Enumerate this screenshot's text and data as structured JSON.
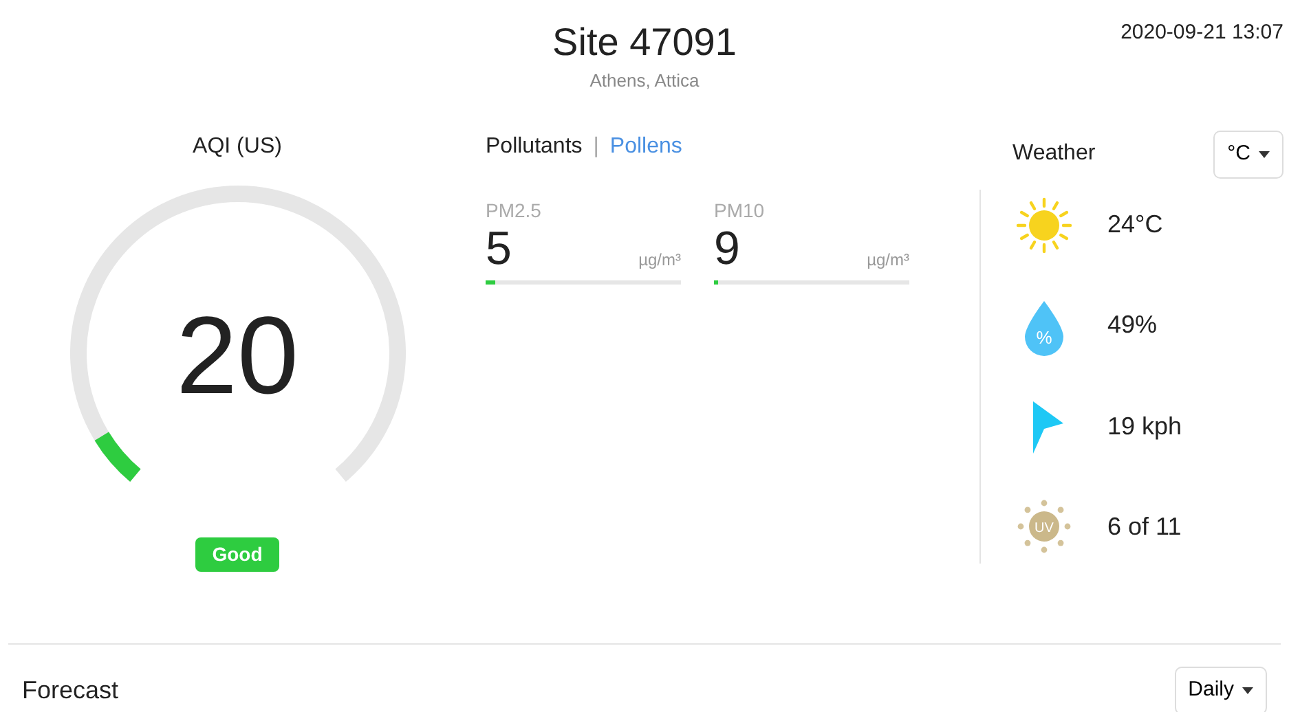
{
  "header": {
    "title": "Site 47091",
    "location": "Athens, Attica",
    "timestamp": "2020-09-21 13:07"
  },
  "aqi": {
    "title": "AQI (US)",
    "value": "20",
    "category": "Good",
    "color": "#2ecc40"
  },
  "pollutant_tabs": [
    {
      "label": "Pollutants",
      "selected": true
    },
    {
      "label": "Pollens",
      "selected": false
    }
  ],
  "tab_separator": "|",
  "pollutants": [
    {
      "name": "PM2.5",
      "value": "5",
      "unit": "µg/m³",
      "level": 0.05
    },
    {
      "name": "PM10",
      "value": "9",
      "unit": "µg/m³",
      "level": 0.02
    }
  ],
  "weather": {
    "title": "Weather",
    "unit_button": "°C",
    "rows": [
      {
        "kind": "sun",
        "value": "24°C"
      },
      {
        "kind": "humidity",
        "icon_text": "%",
        "value": "49%"
      },
      {
        "kind": "wind",
        "value": "19 kph"
      },
      {
        "kind": "uv",
        "icon_text": "UV",
        "value": "6 of 11"
      }
    ]
  },
  "forecast": {
    "title": "Forecast",
    "period_button": "Daily"
  }
}
